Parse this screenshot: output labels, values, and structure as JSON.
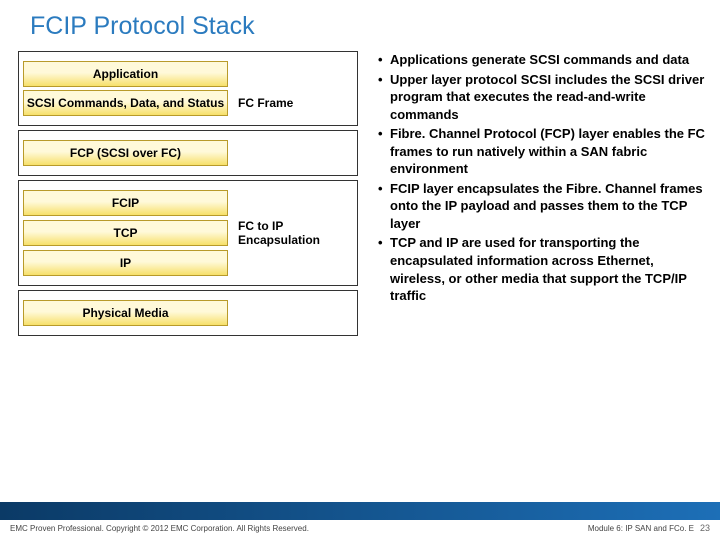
{
  "title": "FCIP Protocol Stack",
  "stack": {
    "group1": [
      {
        "label": "Application",
        "annotation": ""
      },
      {
        "label": "SCSI Commands, Data, and Status",
        "annotation": "FC Frame"
      }
    ],
    "group2": [
      {
        "label": "FCP (SCSI over FC)",
        "annotation": ""
      }
    ],
    "group3": [
      {
        "label": "FCIP",
        "annotation": ""
      },
      {
        "label": "TCP",
        "annotation": "FC to IP Encapsulation"
      },
      {
        "label": "IP",
        "annotation": ""
      }
    ],
    "group4": [
      {
        "label": "Physical Media",
        "annotation": ""
      }
    ]
  },
  "bullets": [
    "Applications generate SCSI commands and data",
    "Upper layer protocol SCSI includes the SCSI driver program that executes the read-and-write commands",
    "Fibre. Channel Protocol (FCP) layer enables the FC frames to run natively within a SAN fabric environment",
    "FCIP layer encapsulates the Fibre. Channel frames onto the IP payload and passes them to the TCP layer",
    "TCP and IP are used for transporting the encapsulated information across Ethernet, wireless, or other media that support the TCP/IP traffic"
  ],
  "footer": {
    "left": "EMC Proven Professional. Copyright © 2012 EMC Corporation. All Rights Reserved.",
    "module": "Module 6: IP SAN and FCo. E",
    "page": "23"
  }
}
